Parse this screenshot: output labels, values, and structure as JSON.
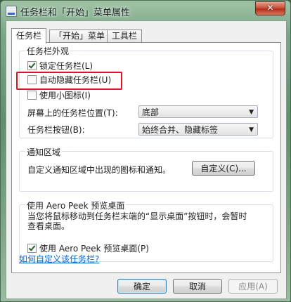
{
  "window": {
    "title": "任务栏和「开始」菜单属性",
    "close_glyph": "✕"
  },
  "tabs": [
    {
      "label": "任务栏",
      "active": true
    },
    {
      "label": "「开始」菜单",
      "active": false
    },
    {
      "label": "工具栏",
      "active": false
    }
  ],
  "appearance": {
    "title": "任务栏外观",
    "lock": {
      "label": "锁定任务栏(L)",
      "checked": true
    },
    "autohide": {
      "label": "自动隐藏任务栏(U)",
      "checked": false
    },
    "small_icons": {
      "label": "使用小图标(I)",
      "checked": false
    },
    "location_label": "屏幕上的任务栏位置(T):",
    "location_value": "底部",
    "buttons_label": "任务栏按钮(B):",
    "buttons_value": "始终合并、隐藏标签"
  },
  "notification": {
    "title": "通知区域",
    "desc": "自定义通知区域中出现的图标和通知。",
    "customize_button": "自定义(C)..."
  },
  "aero_peek": {
    "title": "使用 Aero Peek 预览桌面",
    "desc_line1": "当您将鼠标移动到任务栏末端的“显示桌面”按钮时，会暂时",
    "desc_line2": "查看桌面。",
    "checkbox": {
      "label": "使用 Aero Peek 预览桌面(P)",
      "checked": true
    }
  },
  "help_link": "如何自定义该任务栏?",
  "footer": {
    "ok": "确定",
    "cancel": "取消",
    "apply": "应用(A)"
  },
  "colors": {
    "highlight": "#e0141e",
    "link": "#0066cc"
  }
}
